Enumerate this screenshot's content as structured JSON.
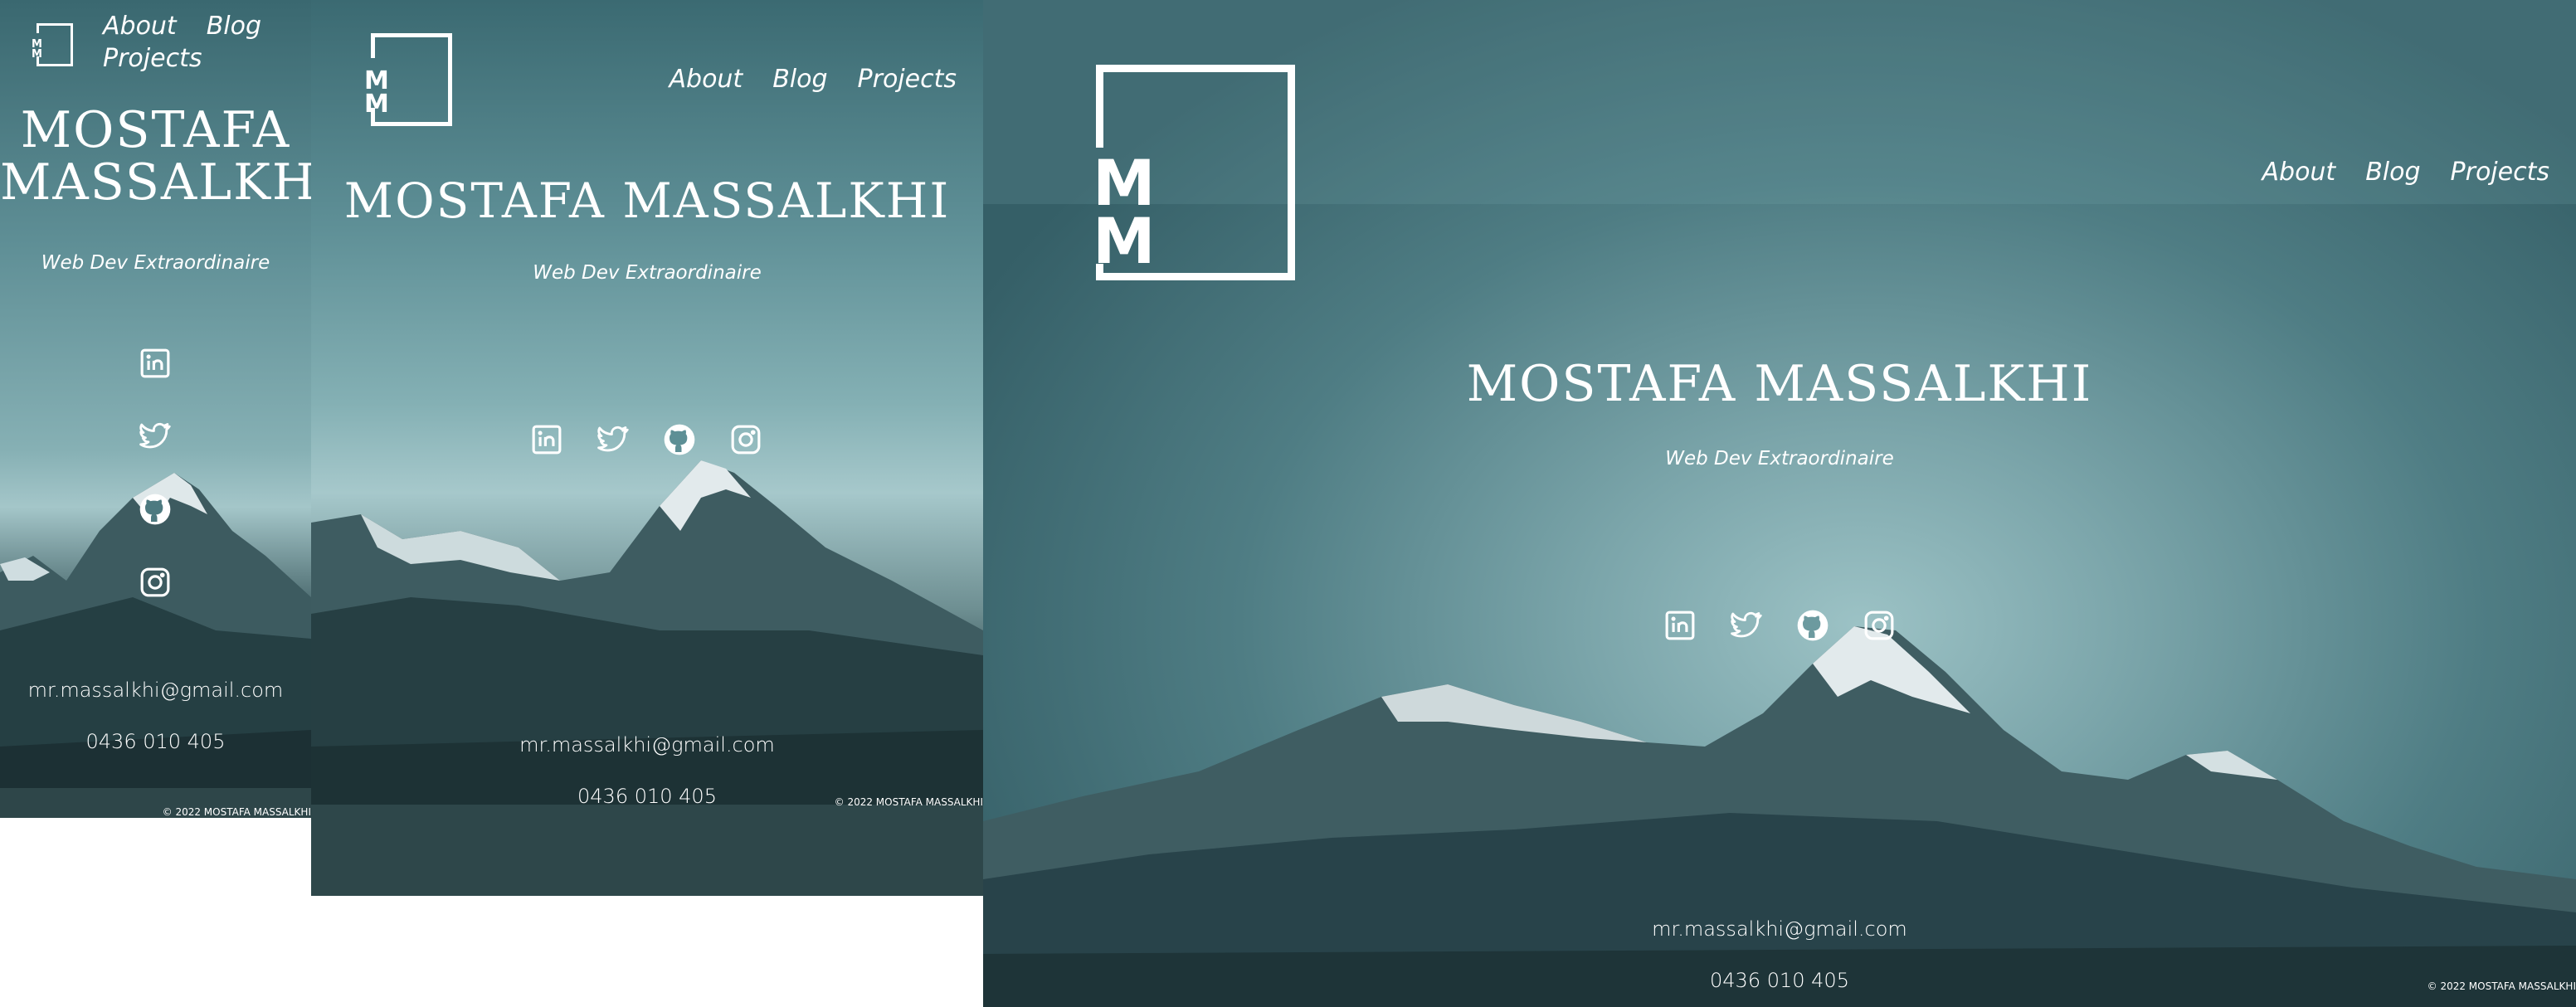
{
  "site": {
    "logo_text": "MM",
    "logo_line1": "M",
    "logo_line2": "M",
    "nav": {
      "about": "About",
      "blog": "Blog",
      "projects": "Projects"
    },
    "name": "MOSTAFA MASSALKHI",
    "name_line1": "MOSTAFA",
    "name_line2": "MASSALKHI",
    "tagline": "Web Dev Extraordinaire",
    "email": "mr.massalkhi@gmail.com",
    "phone": "0436 010 405",
    "copyright": "© 2022 MOSTAFA MASSALKHI"
  },
  "social_icons": [
    "linkedin-icon",
    "twitter-icon",
    "github-icon",
    "instagram-icon"
  ],
  "colors": {
    "sky_top": "#2f5a63",
    "sky_mid": "#5e8e95",
    "sky_glow": "#9fc4c8",
    "mountain_dark": "#1f3a3f",
    "snow": "#dfe8ea"
  }
}
